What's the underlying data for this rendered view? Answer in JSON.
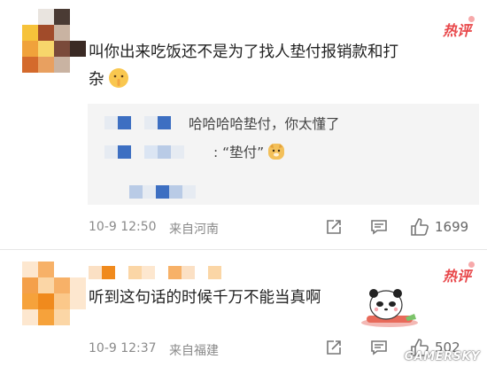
{
  "comments": [
    {
      "hot_label": "热评",
      "text_line1": "叫你出来吃饭还不是为了找人垫付报销款和打",
      "text_line2": "杂",
      "emoji": "shush-emoji",
      "quote": {
        "line1": "哈哈哈哈垫付，你太懂了",
        "line2": ": “垫付”",
        "line2_emoji": "doge-emoji"
      },
      "time": "10-9 12:50",
      "location": "来自河南",
      "likes": "1699"
    },
    {
      "hot_label": "热评",
      "text": "听到这句话的时候千万不能当真啊",
      "sticker": "panda-sticker",
      "time": "10-9 12:37",
      "location": "来自福建",
      "likes": "502"
    }
  ],
  "watermark": "GAMERSKY",
  "colors": {
    "hot": "#e8474a",
    "meta": "#8a8a8a",
    "quote_bg": "#f4f4f4"
  }
}
